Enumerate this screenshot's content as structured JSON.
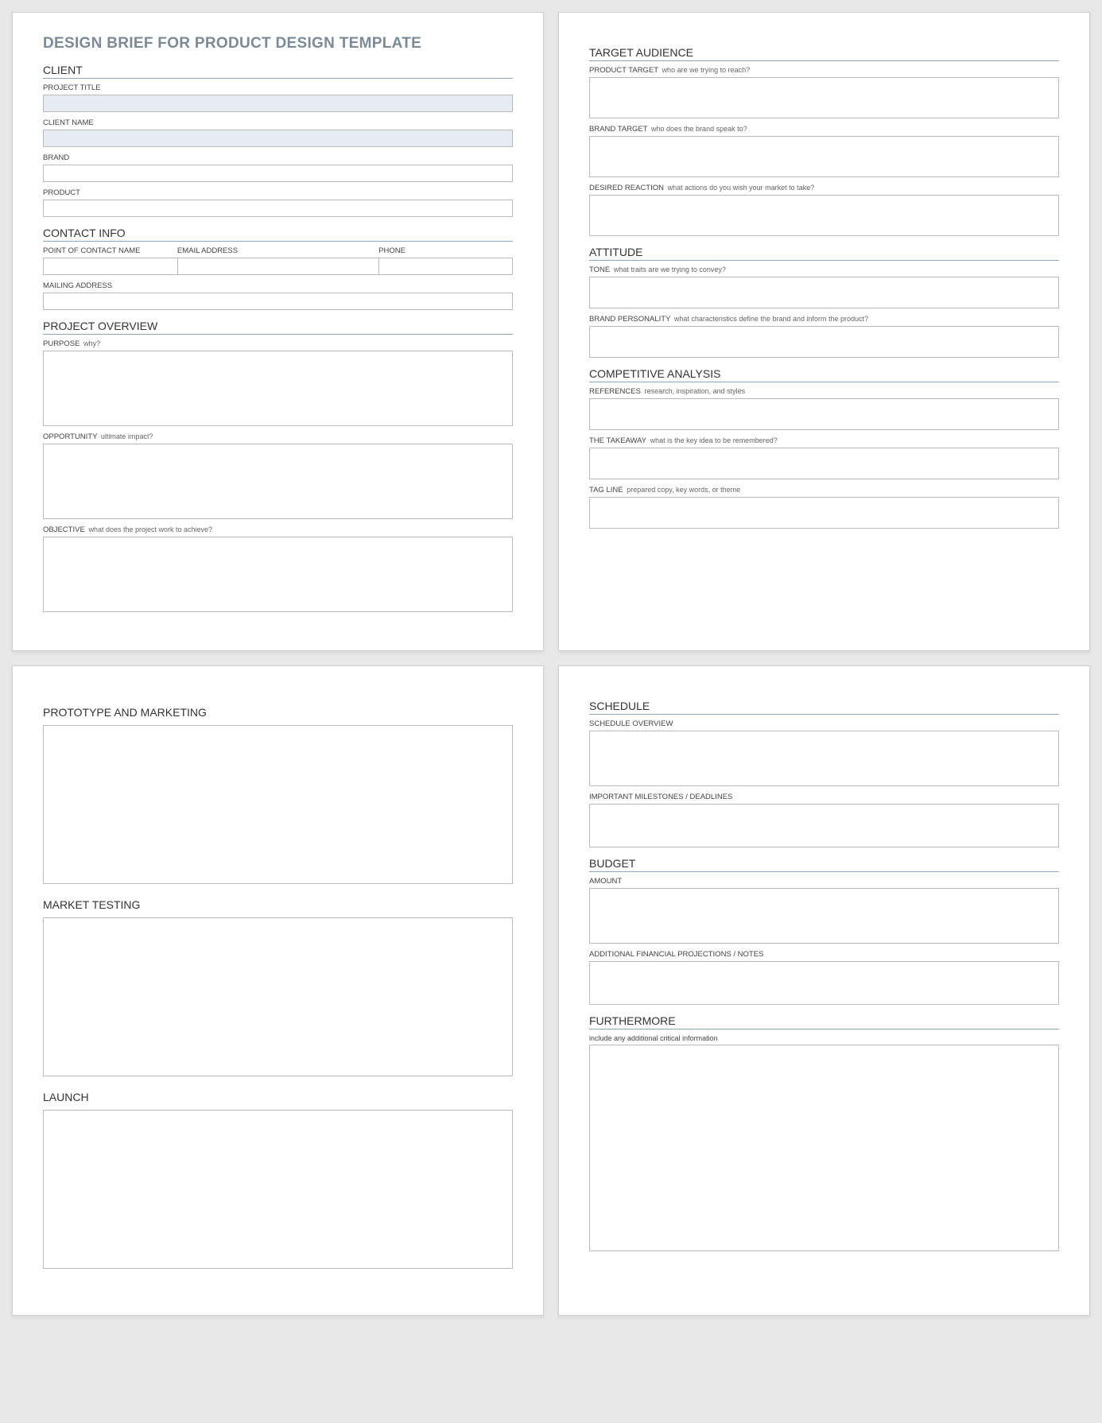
{
  "title": "DESIGN BRIEF FOR PRODUCT DESIGN TEMPLATE",
  "page1": {
    "client": {
      "title": "CLIENT",
      "project_title_label": "PROJECT TITLE",
      "client_name_label": "CLIENT NAME",
      "brand_label": "BRAND",
      "product_label": "PRODUCT"
    },
    "contact": {
      "title": "CONTACT INFO",
      "poc_label": "POINT OF CONTACT NAME",
      "email_label": "EMAIL ADDRESS",
      "phone_label": "PHONE",
      "mailing_label": "MAILING ADDRESS"
    },
    "overview": {
      "title": "PROJECT OVERVIEW",
      "purpose_label": "PURPOSE",
      "purpose_hint": "why?",
      "opportunity_label": "OPPORTUNITY",
      "opportunity_hint": "ultimate impact?",
      "objective_label": "OBJECTIVE",
      "objective_hint": "what does the project work to achieve?"
    }
  },
  "page2": {
    "target_audience": {
      "title": "TARGET AUDIENCE",
      "product_target_label": "PRODUCT TARGET",
      "product_target_hint": "who are we trying to reach?",
      "brand_target_label": "BRAND TARGET",
      "brand_target_hint": "who does the brand speak to?",
      "desired_reaction_label": "DESIRED REACTION",
      "desired_reaction_hint": "what actions do you wish your market to take?"
    },
    "attitude": {
      "title": "ATTITUDE",
      "tone_label": "TONE",
      "tone_hint": "what traits are we trying to convey?",
      "brand_personality_label": "BRAND PERSONALITY",
      "brand_personality_hint": "what characteristics define the brand and inform the product?"
    },
    "competitive": {
      "title": "COMPETITIVE ANALYSIS",
      "references_label": "REFERENCES",
      "references_hint": "research, inspiration, and styles",
      "takeaway_label": "THE TAKEAWAY",
      "takeaway_hint": "what is the key idea to be remembered?",
      "tagline_label": "TAG LINE",
      "tagline_hint": "prepared copy, key words, or theme"
    }
  },
  "page3": {
    "prototype_title": "PROTOTYPE AND MARKETING",
    "market_testing_title": "MARKET TESTING",
    "launch_title": "LAUNCH"
  },
  "page4": {
    "schedule": {
      "title": "SCHEDULE",
      "overview_label": "SCHEDULE OVERVIEW",
      "milestones_label": "IMPORTANT MILESTONES / DEADLINES"
    },
    "budget": {
      "title": "BUDGET",
      "amount_label": "AMOUNT",
      "notes_label": "ADDITIONAL FINANCIAL PROJECTIONS / NOTES"
    },
    "furthermore": {
      "title": "FURTHERMORE",
      "hint": "include any additional critical information"
    }
  }
}
